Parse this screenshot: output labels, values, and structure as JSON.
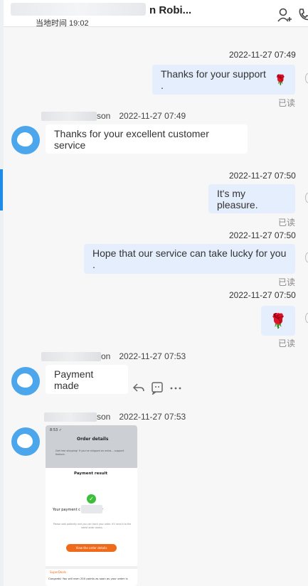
{
  "header": {
    "title": "n Robi...",
    "local_time": "当地时间 19:02"
  },
  "messages": {
    "m1": {
      "time": "2022-11-27 07:49",
      "text": "Thanks for your support .",
      "emoji": "🌹",
      "read": "已读"
    },
    "m2": {
      "sender": "son",
      "time": "2022-11-27 07:49",
      "text": "Thanks for your excellent customer service"
    },
    "m3": {
      "time": "2022-11-27 07:50",
      "text": "It's my pleasure.",
      "read": "已读"
    },
    "m4": {
      "time": "2022-11-27 07:50",
      "text": "Hope that our service can take lucky for you .",
      "read": "已读"
    },
    "m5": {
      "time": "2022-11-27 07:50",
      "emoji": "🌹",
      "read": "已读"
    },
    "m6": {
      "sender": "on",
      "time": "2022-11-27 07:53",
      "text": "Payment made"
    },
    "m7": {
      "sender": "son",
      "time": "2022-11-27 07:53"
    }
  },
  "attachment": {
    "status_time": "8:53 ✓",
    "order_title": "Order details",
    "order_text": "Get free shipping! If you've shipped an extra... support feature.",
    "panel_title": "Payment result",
    "pay_text": "Your payment c                 successfully",
    "sub_text": "Please wait patiently and you can track your order. It'll send it to the latest order status.",
    "button": "View the order details",
    "brand": "SuperDeals",
    "congrats": "Congrats! You will earn 250 points as soon as your order is"
  },
  "colors": {
    "accent": "#1c8ce8",
    "outgoing_bubble": "#e4eefc",
    "avatar": "#4ba6ec"
  }
}
